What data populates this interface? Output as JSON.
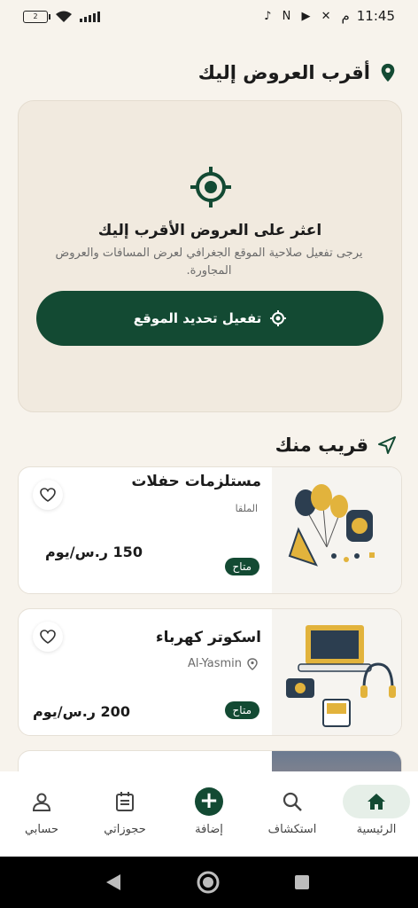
{
  "status_bar": {
    "time": "11:45",
    "am_pm": "م",
    "battery": "2",
    "notification_icons": "♪ N ▶ ✕"
  },
  "nearest_section": {
    "title": "أقرب العروض إليك"
  },
  "location_card": {
    "title": "اعثر على العروض الأقرب إليك",
    "subtitle": "يرجى تفعيل صلاحية الموقع الجغرافي لعرض المسافات والعروض المجاورة.",
    "button_label": "تفعيل تحديد الموقع"
  },
  "nearby_section": {
    "title": "قريب منك"
  },
  "listings": [
    {
      "title": "مستلزمات حفلات",
      "location": "الملقا",
      "price": "150 ر.س/يوم",
      "status": "متاح",
      "image": "party-balloons"
    },
    {
      "title": "اسكوتر كهرباء",
      "location": "Al-Yasmin",
      "price": "200 ر.س/يوم",
      "status": "متاح",
      "image": "electronics"
    }
  ],
  "bottom_nav": {
    "items": [
      {
        "label": "الرئيسية",
        "icon": "home-icon",
        "active": true
      },
      {
        "label": "استكشاف",
        "icon": "search-icon"
      },
      {
        "label": "إضافة",
        "icon": "add-icon"
      },
      {
        "label": "حجوزاتي",
        "icon": "calendar-icon"
      },
      {
        "label": "حسابي",
        "icon": "person-icon"
      }
    ]
  },
  "colors": {
    "primary": "#134a33",
    "background": "#f7f3ec",
    "card_bg": "#f1eadf"
  }
}
